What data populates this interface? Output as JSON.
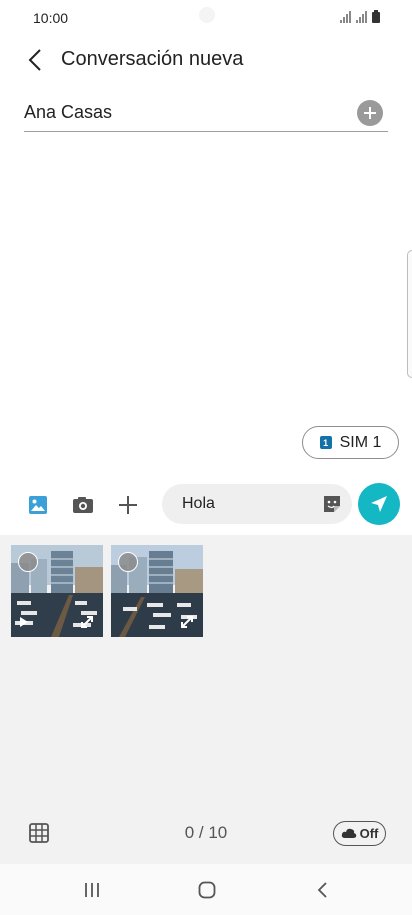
{
  "status_bar": {
    "time": "10:00"
  },
  "header": {
    "title": "Conversación nueva"
  },
  "recipient": {
    "name": "Ana Casas"
  },
  "sim": {
    "badge": "1",
    "label": "SIM 1"
  },
  "composer": {
    "message": "Hola"
  },
  "gallery": {
    "thumbnails": [
      {
        "kind": "video",
        "selected": false
      },
      {
        "kind": "photo",
        "selected": false
      }
    ],
    "counter": "0 / 10",
    "toggle_label": "Off"
  },
  "colors": {
    "accent": "#14b7c4",
    "sim_badge": "#1572a8",
    "gallery_bg": "#f2f2f2"
  },
  "icons": {
    "status": [
      "signal-icon",
      "signal-icon",
      "battery-icon"
    ],
    "composer": [
      "gallery-icon",
      "camera-icon",
      "plus-icon",
      "sticker-icon",
      "send-icon"
    ],
    "footer": [
      "grid-icon",
      "cloud-icon"
    ],
    "nav": [
      "recents-icon",
      "home-icon",
      "back-icon"
    ]
  }
}
